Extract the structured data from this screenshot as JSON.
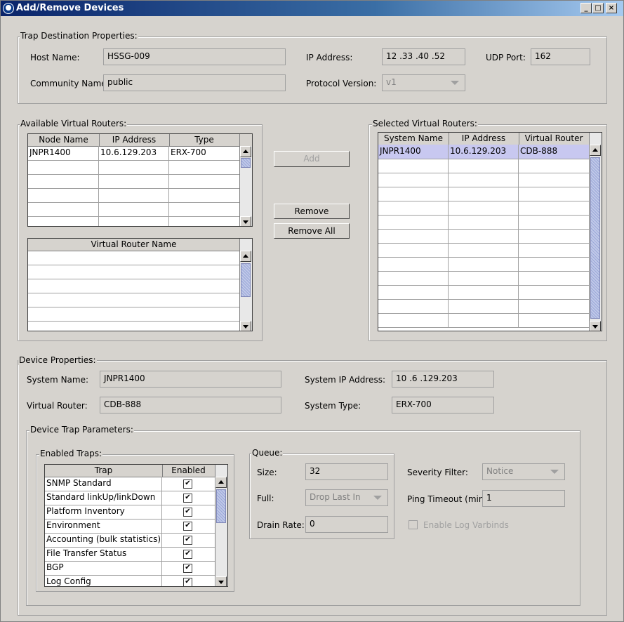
{
  "window": {
    "title": "Add/Remove Devices"
  },
  "trap_destination": {
    "title": "Trap Destination Properties:",
    "host_name_label": "Host Name:",
    "host_name": "HSSG-009",
    "ip_address_label": "IP Address:",
    "ip_address": "12 .33 .40 .52",
    "udp_port_label": "UDP Port:",
    "udp_port": "162",
    "community_name_label": "Community Name:",
    "community_name": "public",
    "protocol_version_label": "Protocol Version:",
    "protocol_version": "v1"
  },
  "available": {
    "title": "Available Virtual Routers:",
    "columns": [
      "Node Name",
      "IP Address",
      "Type"
    ],
    "rows": [
      [
        "JNPR1400",
        "10.6.129.203",
        "ERX-700"
      ]
    ],
    "vr_column": "Virtual Router Name"
  },
  "actions": {
    "add": "Add",
    "remove": "Remove",
    "remove_all": "Remove All"
  },
  "selected": {
    "title": "Selected Virtual Routers:",
    "columns": [
      "System Name",
      "IP Address",
      "Virtual Router"
    ],
    "rows": [
      [
        "JNPR1400",
        "10.6.129.203",
        "CDB-888"
      ]
    ]
  },
  "device": {
    "title": "Device Properties:",
    "system_name_label": "System Name:",
    "system_name": "JNPR1400",
    "system_ip_label": "System IP Address:",
    "system_ip": "10 .6 .129.203",
    "virtual_router_label": "Virtual Router:",
    "virtual_router": "CDB-888",
    "system_type_label": "System Type:",
    "system_type": "ERX-700"
  },
  "trap_params": {
    "title": "Device Trap Parameters:",
    "enabled_traps_title": "Enabled Traps:",
    "columns": [
      "Trap",
      "Enabled"
    ],
    "traps": [
      {
        "name": "SNMP Standard",
        "enabled": "✔"
      },
      {
        "name": "Standard linkUp/linkDown",
        "enabled": "✔"
      },
      {
        "name": "Platform Inventory",
        "enabled": "✔"
      },
      {
        "name": "Environment",
        "enabled": "✔"
      },
      {
        "name": "Accounting (bulk statistics)",
        "enabled": "✔"
      },
      {
        "name": "File Transfer Status",
        "enabled": "✔"
      },
      {
        "name": "BGP",
        "enabled": "✔"
      },
      {
        "name": "Log Config",
        "enabled": "✔"
      }
    ],
    "queue_title": "Queue:",
    "size_label": "Size:",
    "size": "32",
    "full_label": "Full:",
    "full": "Drop Last In",
    "drain_rate_label": "Drain Rate:",
    "drain_rate": "0",
    "severity_label": "Severity Filter:",
    "severity": "Notice",
    "ping_label": "Ping Timeout (min):",
    "ping": "1",
    "log_varbinds_label": "Enable Log Varbinds"
  }
}
